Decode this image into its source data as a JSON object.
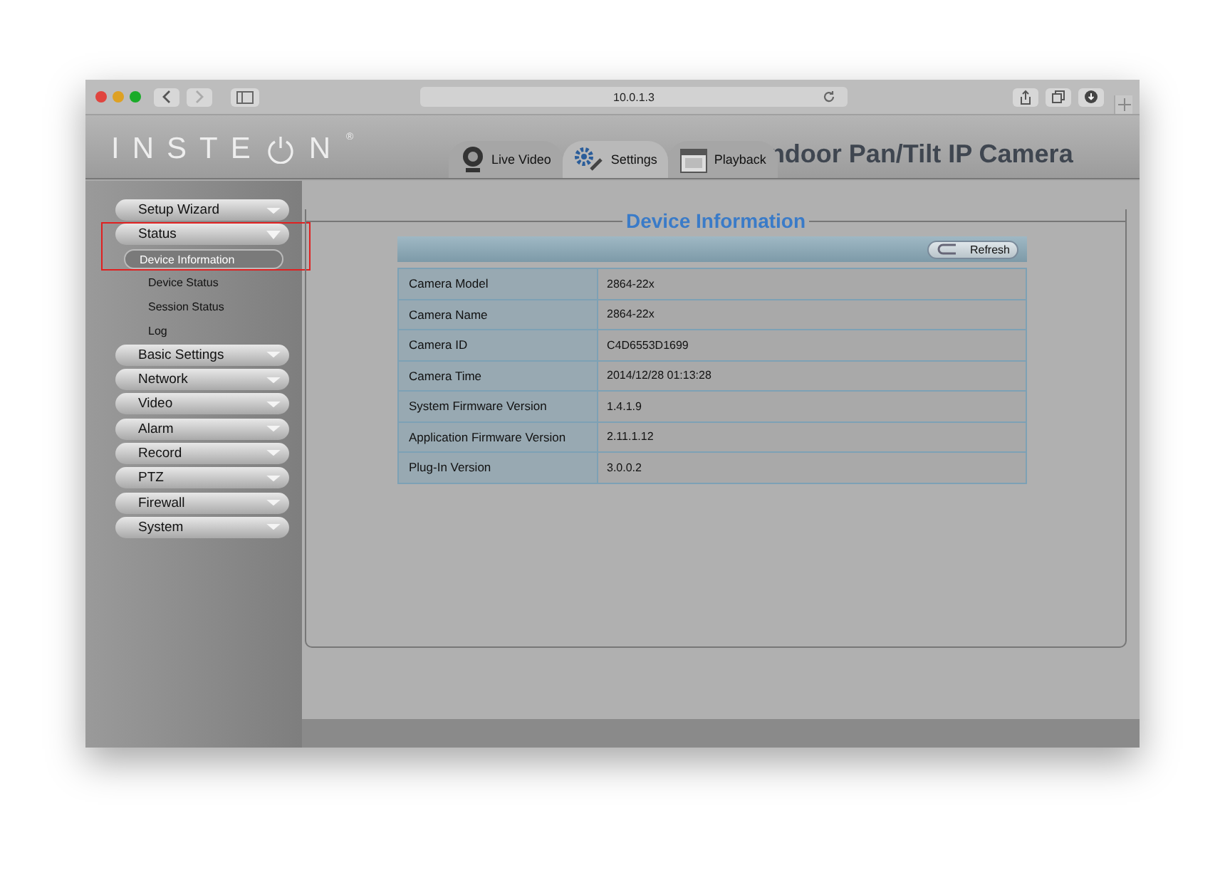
{
  "browser": {
    "url": "10.0.1.3"
  },
  "header": {
    "logo_left": "INSTE",
    "logo_right": "N",
    "logo_mark": "®",
    "title": "ndoor Pan/Tilt IP Camera",
    "tabs": [
      {
        "label": "Live Video",
        "selected": false
      },
      {
        "label": "Settings",
        "selected": true
      },
      {
        "label": "Playback",
        "selected": false
      }
    ]
  },
  "sidebar": {
    "items": [
      {
        "label": "Setup Wizard",
        "expanded": false
      },
      {
        "label": "Status",
        "expanded": true,
        "children": [
          {
            "label": "Device Information",
            "selected": true
          },
          {
            "label": "Device Status",
            "selected": false
          },
          {
            "label": "Session Status",
            "selected": false
          },
          {
            "label": "Log",
            "selected": false
          }
        ]
      },
      {
        "label": "Basic Settings",
        "expanded": false
      },
      {
        "label": "Network",
        "expanded": false
      },
      {
        "label": "Video",
        "expanded": false
      },
      {
        "label": "Alarm",
        "expanded": false
      },
      {
        "label": "Record",
        "expanded": false
      },
      {
        "label": "PTZ",
        "expanded": false
      },
      {
        "label": "Firewall",
        "expanded": false
      },
      {
        "label": "System",
        "expanded": false
      }
    ]
  },
  "panel": {
    "title": "Device Information",
    "refresh_button": "Refresh",
    "rows": [
      {
        "label": "Camera Model",
        "value": "2864-22x"
      },
      {
        "label": "Camera Name",
        "value": "2864-22x"
      },
      {
        "label": "Camera ID",
        "value": "C4D6553D1699"
      },
      {
        "label": "Camera Time",
        "value": "2014/12/28 01:13:28"
      },
      {
        "label": "System Firmware Version",
        "value": "1.4.1.9"
      },
      {
        "label": "Application Firmware Version",
        "value": "2.11.1.12"
      },
      {
        "label": "Plug-In Version",
        "value": "3.0.0.2"
      }
    ]
  }
}
